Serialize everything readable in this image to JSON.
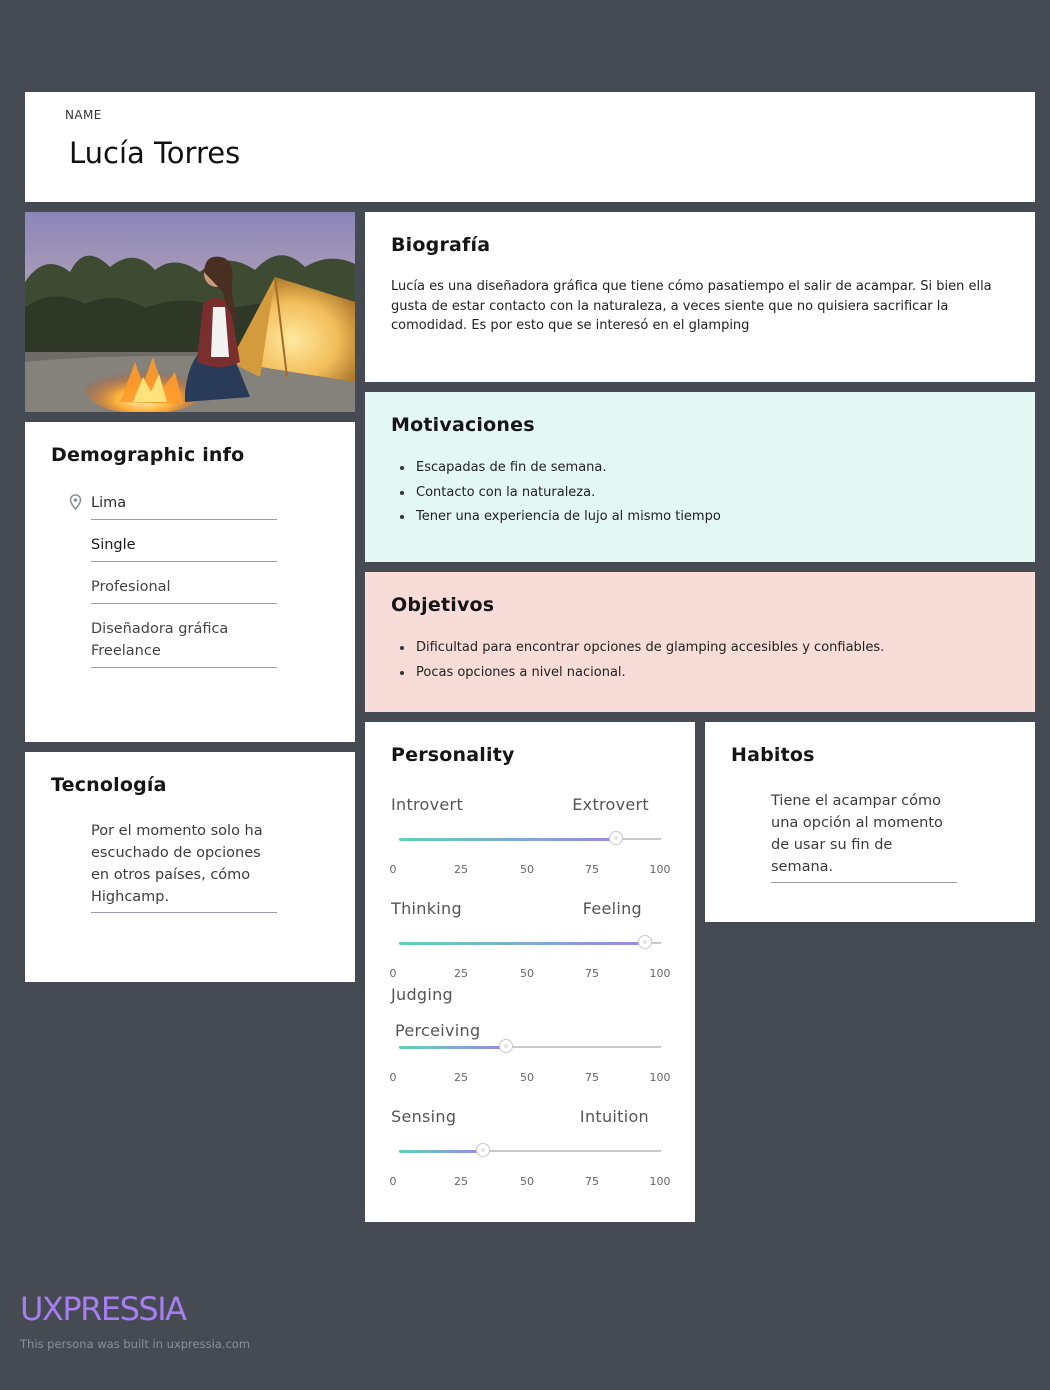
{
  "header": {
    "name_label": "NAME",
    "persona_name": "Lucía Torres"
  },
  "photo": {
    "alt": "Persona photo"
  },
  "demographic": {
    "title": "Demographic info",
    "location": "Lima",
    "status": "Single",
    "education": "Profesional",
    "occupation_line1": "Diseñadora gráfica",
    "occupation_line2": "Freelance"
  },
  "technology": {
    "title": "Tecnología",
    "text": "Por el momento solo ha escuchado de opciones en otros países, cómo Highcamp."
  },
  "biography": {
    "title": "Biografía",
    "text": "Lucía es una diseñadora gráfica que tiene cómo pasatiempo el salir de acampar. Si bien ella gusta de estar contacto con la naturaleza, a veces siente que no quisiera sacrificar la comodidad. Es por esto que se interesó en el glamping"
  },
  "motivations": {
    "title": "Motivaciones",
    "items": [
      "Escapadas de fin de semana.",
      "Contacto con la naturaleza.",
      "Tener una experiencia de lujo al mismo tiempo"
    ]
  },
  "objectives": {
    "title": "Objetivos",
    "items": [
      "Dificultad para encontrar opciones de glamping accesibles y confiables.",
      "Pocas opciones a nivel nacional."
    ]
  },
  "personality": {
    "title": "Personality",
    "ticks": [
      "0",
      "25",
      "50",
      "75",
      "100"
    ],
    "sliders": [
      {
        "left": "Introvert",
        "right": "Extrovert",
        "value": 83
      },
      {
        "left": "Thinking",
        "right": "Feeling",
        "value": 94
      },
      {
        "left": "Judging",
        "right": "Perceiving",
        "value": 41
      },
      {
        "left": "Sensing",
        "right": "Intuition",
        "value": 32
      }
    ]
  },
  "habits": {
    "title": "Habitos",
    "text": "Tiene el acampar cómo una opción al momento de usar su fin de semana."
  },
  "footer": {
    "brand": "UXPRESSIA",
    "caption": "This persona was built in uxpressia.com"
  },
  "colors": {
    "background": "#464a52",
    "motivations_bg": "#e3f7f3",
    "objectives_bg": "#f8dcd8",
    "slider_start": "#5fd3b4",
    "slider_end": "#9b88e6",
    "brand": "#a57ef0"
  }
}
